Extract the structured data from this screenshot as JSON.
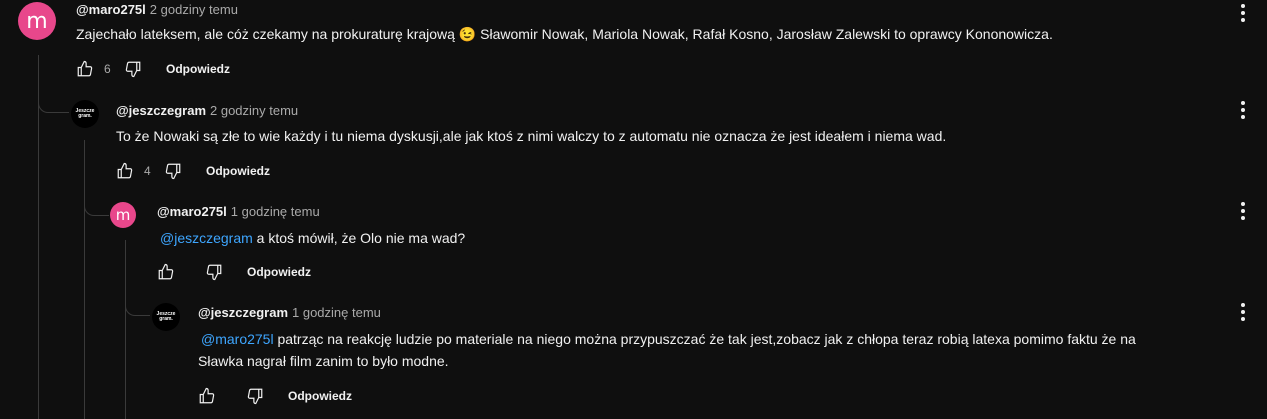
{
  "comments": [
    {
      "author": "@maro275l",
      "time": "2 godziny temu",
      "avatar_letter": "m",
      "text": "Zajechało lateksem, ale cóż czekamy na prokuraturę krajową 😉  Sławomir Nowak, Mariola Nowak, Rafał Kosno, Jarosław Zalewski to oprawcy Kononowicza.",
      "likes": "6",
      "reply_label": "Odpowiedz"
    },
    {
      "author": "@jeszczegram",
      "time": "2 godziny temu",
      "avatar_text": "Jeszcze gram.",
      "text": "To że Nowaki są złe to wie każdy i tu niema dyskusji,ale jak ktoś z nimi walczy to z automatu nie oznacza że jest ideałem i niema wad.",
      "likes": "4",
      "reply_label": "Odpowiedz"
    },
    {
      "author": "@maro275l",
      "time": "1 godzinę temu",
      "avatar_letter": "m",
      "mention": "@jeszczegram",
      "text": " a ktoś mówił, że Olo nie ma wad?",
      "likes": "",
      "reply_label": "Odpowiedz"
    },
    {
      "author": "@jeszczegram",
      "time": "1 godzinę temu",
      "avatar_text": "Jeszcze gram.",
      "mention": "@maro275l",
      "text": " patrząc na reakcję ludzie po materiale na niego można przypuszczać że tak jest,zobacz jak z chłopa teraz robią latexa pomimo faktu że na",
      "text_line2": "Sławka nagrał film zanim to było modne.",
      "likes": "",
      "reply_label": "Odpowiedz"
    }
  ],
  "colors": {
    "background": "#0f0f0f",
    "avatar_m": "#e8478b",
    "mention": "#3ea6ff",
    "muted": "#aaaaaa"
  },
  "icons": [
    "thumb-up-icon",
    "thumb-down-icon",
    "more-vert-icon"
  ]
}
